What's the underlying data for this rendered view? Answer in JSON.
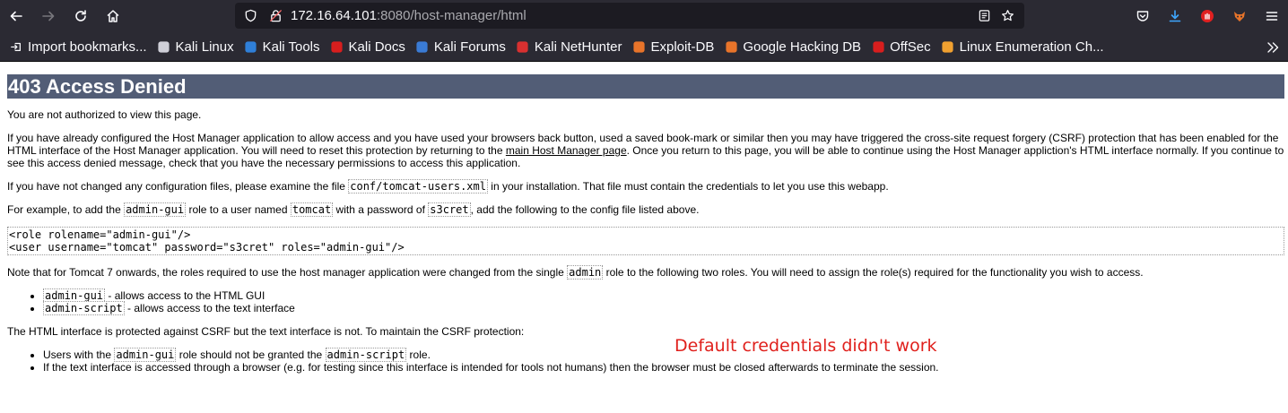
{
  "browser": {
    "url_host": "172.16.64.101",
    "url_port_path": ":8080/host-manager/html",
    "bookmarks": [
      {
        "label": "Import bookmarks...",
        "icon": "import-icon",
        "color": "#fbfbfe"
      },
      {
        "label": "Kali Linux",
        "icon": "kali-dragon-icon",
        "color": "#cfcfd8"
      },
      {
        "label": "Kali Tools",
        "icon": "kali-tools-icon",
        "color": "#2f7fd8"
      },
      {
        "label": "Kali Docs",
        "icon": "kali-docs-icon",
        "color": "#d81e1e"
      },
      {
        "label": "Kali Forums",
        "icon": "kali-forums-icon",
        "color": "#3a7bd5"
      },
      {
        "label": "Kali NetHunter",
        "icon": "kali-nethunter-icon",
        "color": "#d83030"
      },
      {
        "label": "Exploit-DB",
        "icon": "exploit-db-icon",
        "color": "#e8742a"
      },
      {
        "label": "Google Hacking DB",
        "icon": "ghdb-icon",
        "color": "#e8742a"
      },
      {
        "label": "OffSec",
        "icon": "offsec-icon",
        "color": "#d81e1e"
      },
      {
        "label": "Linux Enumeration Ch...",
        "icon": "bookmark-p-icon",
        "color": "#f0a030"
      }
    ]
  },
  "page": {
    "heading": "403 Access Denied",
    "p1": "You are not authorized to view this page.",
    "p2_a": "If you have already configured the Host Manager application to allow access and you have used your browsers back button, used a saved book-mark or similar then you may have triggered the cross-site request forgery (CSRF) protection that has been enabled for the HTML interface of the Host Manager application. You will need to reset this protection by returning to the ",
    "p2_link": "main Host Manager page",
    "p2_b": ". Once you return to this page, you will be able to continue using the Host Manager appliction's HTML interface normally. If you continue to see this access denied message, check that you have the necessary permissions to access this application.",
    "p3_a": "If you have not changed any configuration files, please examine the file ",
    "p3_code": "conf/tomcat-users.xml",
    "p3_b": " in your installation. That file must contain the credentials to let you use this webapp.",
    "p4_a": "For example, to add the ",
    "p4_code1": "admin-gui",
    "p4_b": " role to a user named ",
    "p4_code2": "tomcat",
    "p4_c": " with a password of ",
    "p4_code3": "s3cret",
    "p4_d": ", add the following to the config file listed above.",
    "pre": "<role rolename=\"admin-gui\"/>\n<user username=\"tomcat\" password=\"s3cret\" roles=\"admin-gui\"/>",
    "p5_a": "Note that for Tomcat 7 onwards, the roles required to use the host manager application were changed from the single ",
    "p5_code": "admin",
    "p5_b": " role to the following two roles. You will need to assign the role(s) required for the functionality you wish to access.",
    "roles": [
      {
        "code": "admin-gui",
        "text": " - allows access to the HTML GUI"
      },
      {
        "code": "admin-script",
        "text": " - allows access to the text interface"
      }
    ],
    "p6": "The HTML interface is protected against CSRF but the text interface is not. To maintain the CSRF protection:",
    "csrf_1_a": "Users with the ",
    "csrf_1_code1": "admin-gui",
    "csrf_1_b": " role should not be granted the ",
    "csrf_1_code2": "admin-script",
    "csrf_1_c": " role.",
    "csrf_2": "If the text interface is accessed through a browser (e.g. for testing since this interface is intended for tools not humans) then the browser must be closed afterwards to terminate the session."
  },
  "annotation": "Default credentials didn't work"
}
